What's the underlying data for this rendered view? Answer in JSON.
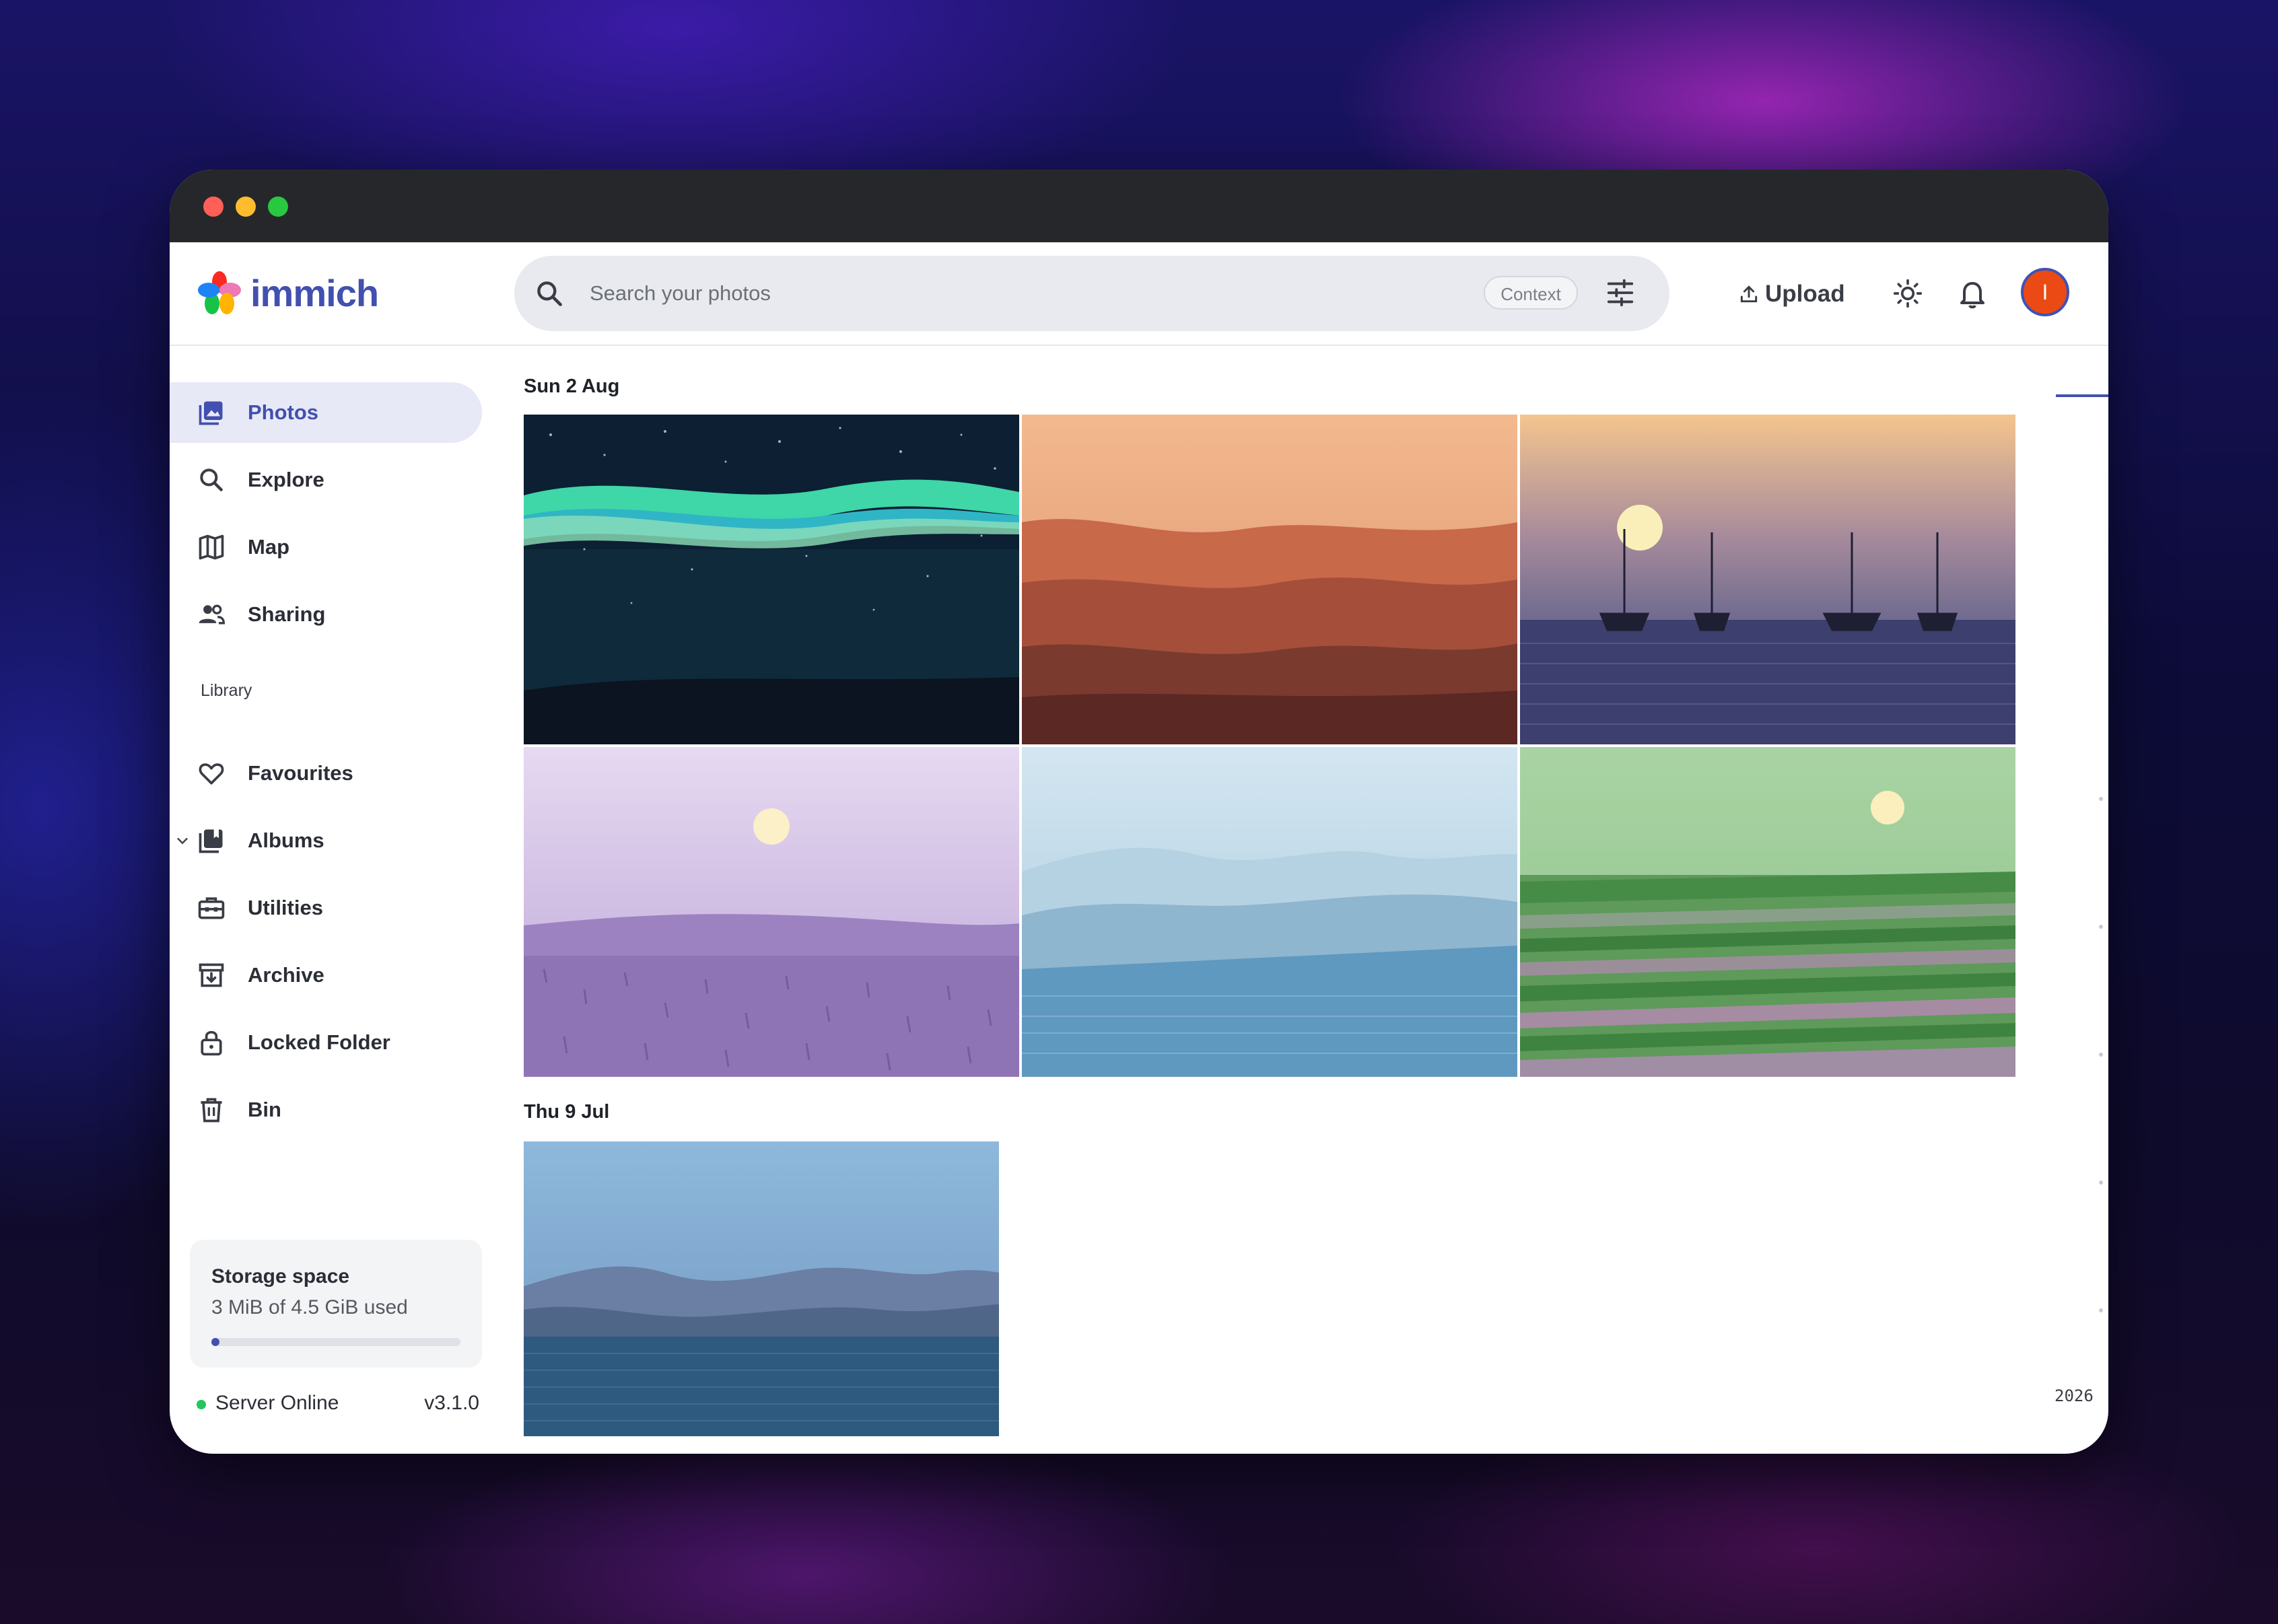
{
  "app": {
    "name": "immich"
  },
  "search": {
    "placeholder": "Search your photos",
    "mode_label": "Context"
  },
  "header": {
    "upload_label": "Upload",
    "avatar_initial": "I"
  },
  "sidebar": {
    "items": [
      {
        "label": "Photos",
        "icon": "photos-icon",
        "active": true
      },
      {
        "label": "Explore",
        "icon": "search-icon"
      },
      {
        "label": "Map",
        "icon": "map-icon"
      },
      {
        "label": "Sharing",
        "icon": "people-icon"
      }
    ],
    "library_label": "Library",
    "library_items": [
      {
        "label": "Favourites",
        "icon": "heart-icon"
      },
      {
        "label": "Albums",
        "icon": "album-icon"
      },
      {
        "label": "Utilities",
        "icon": "toolbox-icon"
      },
      {
        "label": "Archive",
        "icon": "archive-icon"
      },
      {
        "label": "Locked Folder",
        "icon": "lock-icon"
      },
      {
        "label": "Bin",
        "icon": "trash-icon"
      }
    ]
  },
  "storage": {
    "title": "Storage space",
    "used_text": "3 MiB of 4.5 GiB used",
    "used_fraction": 0.0007
  },
  "server": {
    "status": "Server Online",
    "version": "v3.1.0"
  },
  "timeline": {
    "groups": [
      {
        "date": "Sun 2 Aug",
        "photos": [
          "aurora",
          "desert-dunes",
          "sailboats-sunset",
          "lavender-field",
          "blue-waves",
          "green-field"
        ]
      },
      {
        "date": "Thu 9 Jul",
        "photos": [
          "blue-mountains-lake"
        ]
      }
    ],
    "scrubber_year": "2026"
  },
  "colors": {
    "accent": "#4250af",
    "avatar": "#ec4a14",
    "online": "#22c55e"
  }
}
